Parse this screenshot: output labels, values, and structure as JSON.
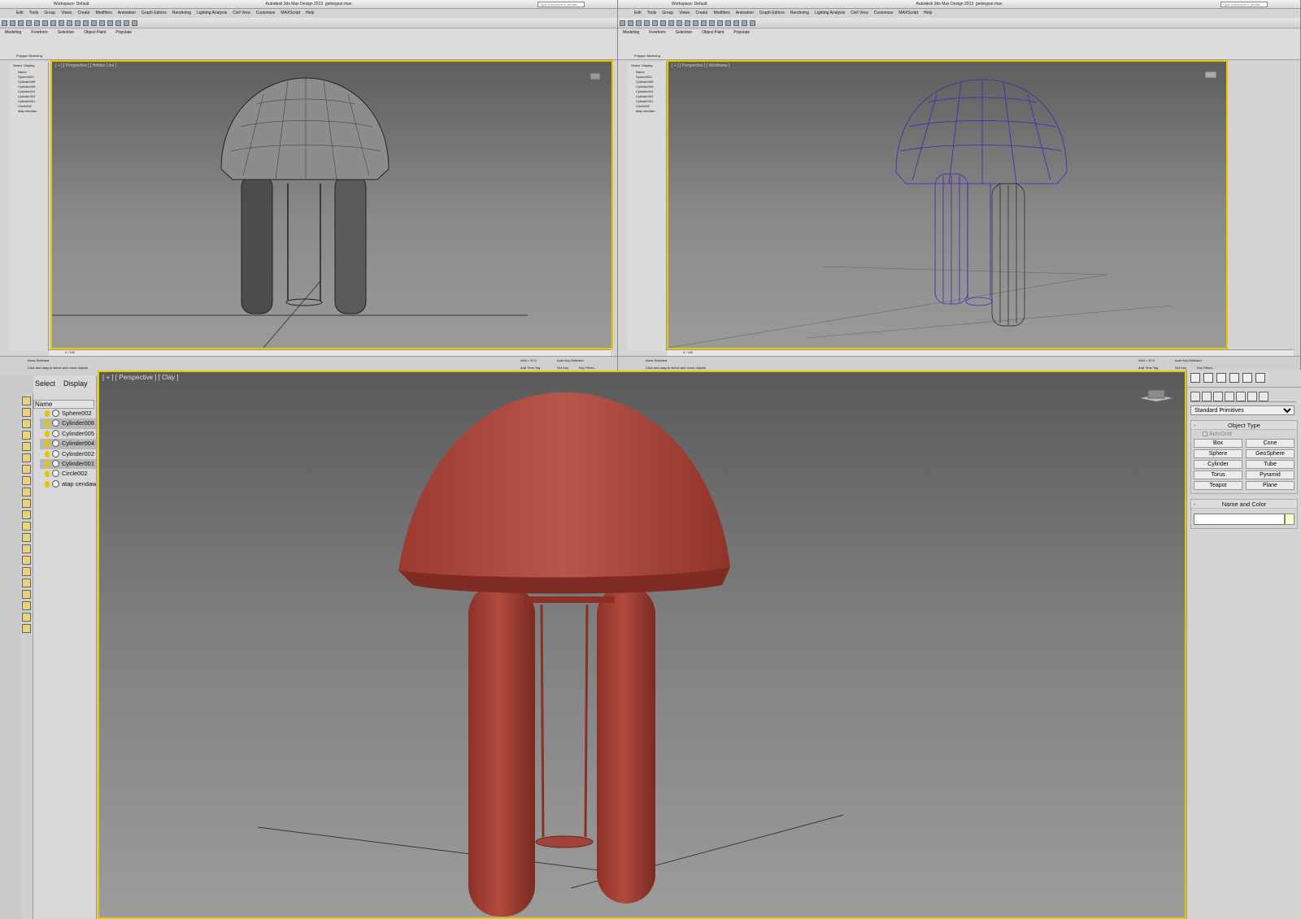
{
  "app": {
    "title": "Autodesk 3ds Max Design 2013",
    "file": "gelongsor.max",
    "workspace": "Workspace: Default",
    "search_placeholder": "Type a keyword or phrase"
  },
  "menus": [
    "Edit",
    "Tools",
    "Group",
    "Views",
    "Create",
    "Modifiers",
    "Animation",
    "Graph Editors",
    "Rendering",
    "Lighting Analysis",
    "Civil View",
    "Customize",
    "MAXScript",
    "Help"
  ],
  "ribbon": {
    "tabs": [
      "Modeling",
      "Freeform",
      "Selection",
      "Object Paint",
      "Populate"
    ],
    "panel_label": "Polygon Modeling"
  },
  "scene_explorer": {
    "tabs": [
      "Select",
      "Display"
    ],
    "column": "Name",
    "items": [
      {
        "name": "Sphere002",
        "selected": false
      },
      {
        "name": "Cylinder006",
        "selected": true
      },
      {
        "name": "Cylinder005",
        "selected": false
      },
      {
        "name": "Cylinder004",
        "selected": true
      },
      {
        "name": "Cylinder002",
        "selected": false
      },
      {
        "name": "Cylinder001",
        "selected": true
      },
      {
        "name": "Circle002",
        "selected": false
      },
      {
        "name": "atap cendaw...",
        "selected": false
      }
    ]
  },
  "viewports": {
    "top_left": "[ + ] [ Perspective ] [ Hidden Line ]",
    "top_right": "[ + ] [ Perspective ] [ Wireframe ]",
    "bottom": "[ + ] [ Perspective ] [ Clay ]"
  },
  "timeline": {
    "frame": "0 / 100"
  },
  "status": {
    "selection": "None Selected",
    "prompt": "Click and drag to select and move objects",
    "grid": "Grid = 10.0",
    "add_time_tag": "Add Time Tag",
    "auto_key": "Auto Key",
    "set_key": "Set Key",
    "key_filters": "Key Filters...",
    "selected": "Selected"
  },
  "command_panel": {
    "dropdown": "Standard Primitives",
    "object_type_title": "Object Type",
    "autogrid": "AutoGrid",
    "primitives": [
      "Box",
      "Cone",
      "Sphere",
      "GeoSphere",
      "Cylinder",
      "Tube",
      "Torus",
      "Pyramid",
      "Teapot",
      "Plane"
    ],
    "name_color_title": "Name and Color"
  },
  "colors": {
    "viewport_border": "#e2c900",
    "clay": "#b3473c",
    "wire": "#4b1fb5"
  }
}
